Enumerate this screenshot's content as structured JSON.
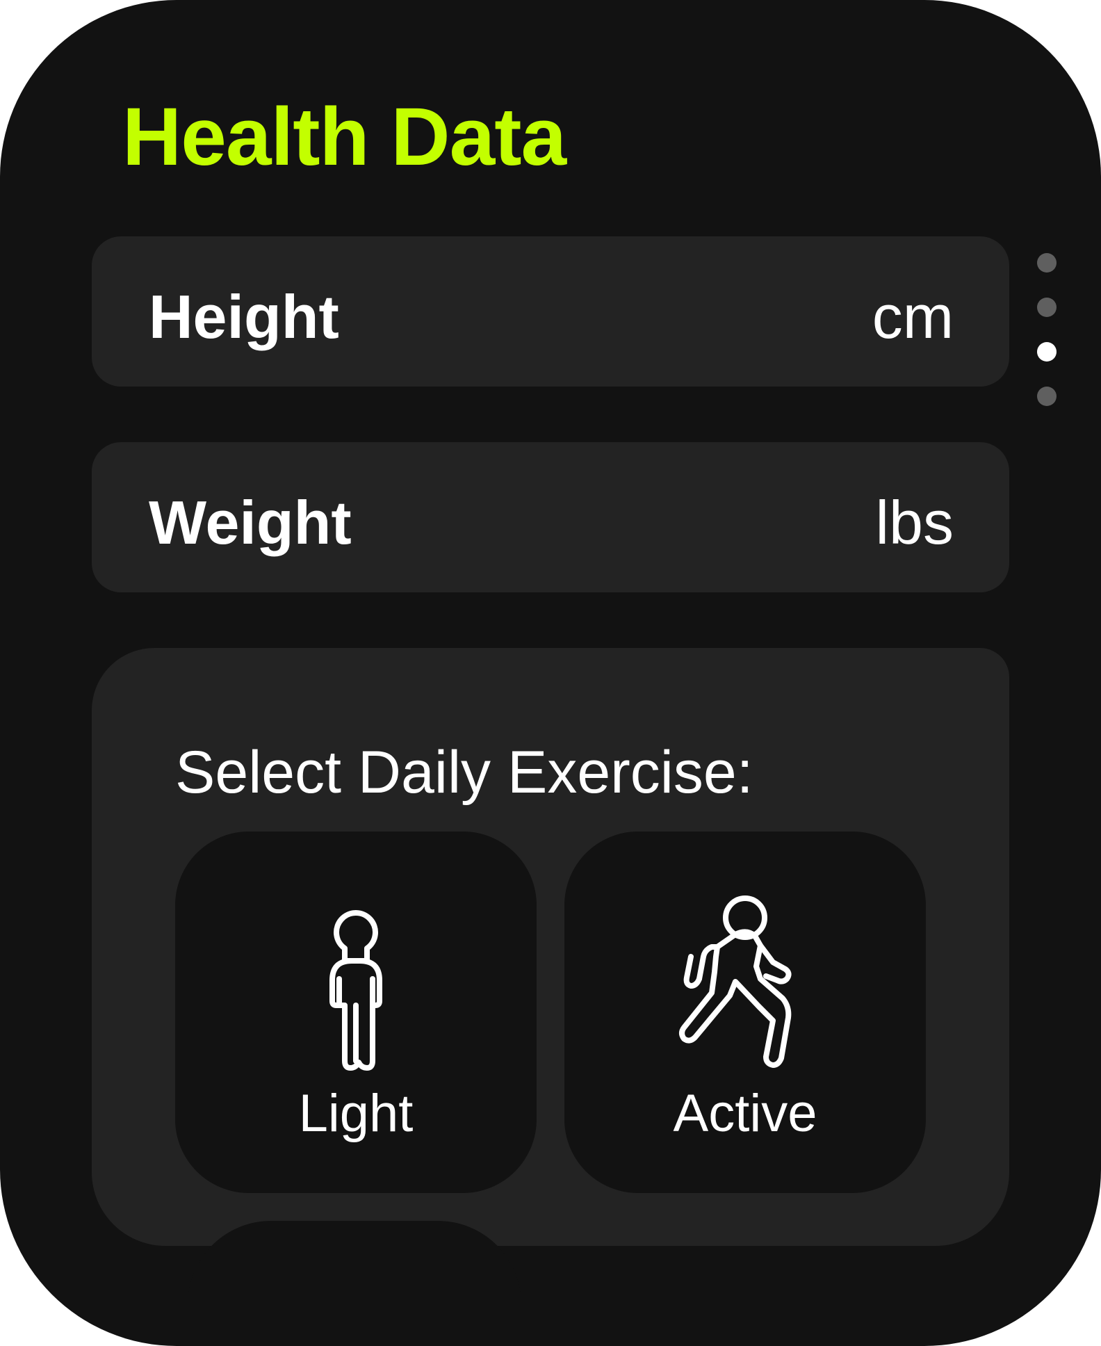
{
  "app": {
    "title": "Health Data",
    "accent_color": "#c3ff00",
    "background_color": "#121212",
    "card_color": "#232323"
  },
  "measurements": [
    {
      "label": "Height",
      "unit": "cm"
    },
    {
      "label": "Weight",
      "unit": "lbs"
    }
  ],
  "exercise": {
    "heading": "Select Daily Exercise:",
    "options": [
      {
        "label": "Light",
        "icon": "standing-person-icon"
      },
      {
        "label": "Active",
        "icon": "walking-person-icon"
      }
    ]
  },
  "page_indicator": {
    "total": 4,
    "current_index": 2,
    "active_color": "#ffffff",
    "inactive_color": "#5f5f5f"
  }
}
